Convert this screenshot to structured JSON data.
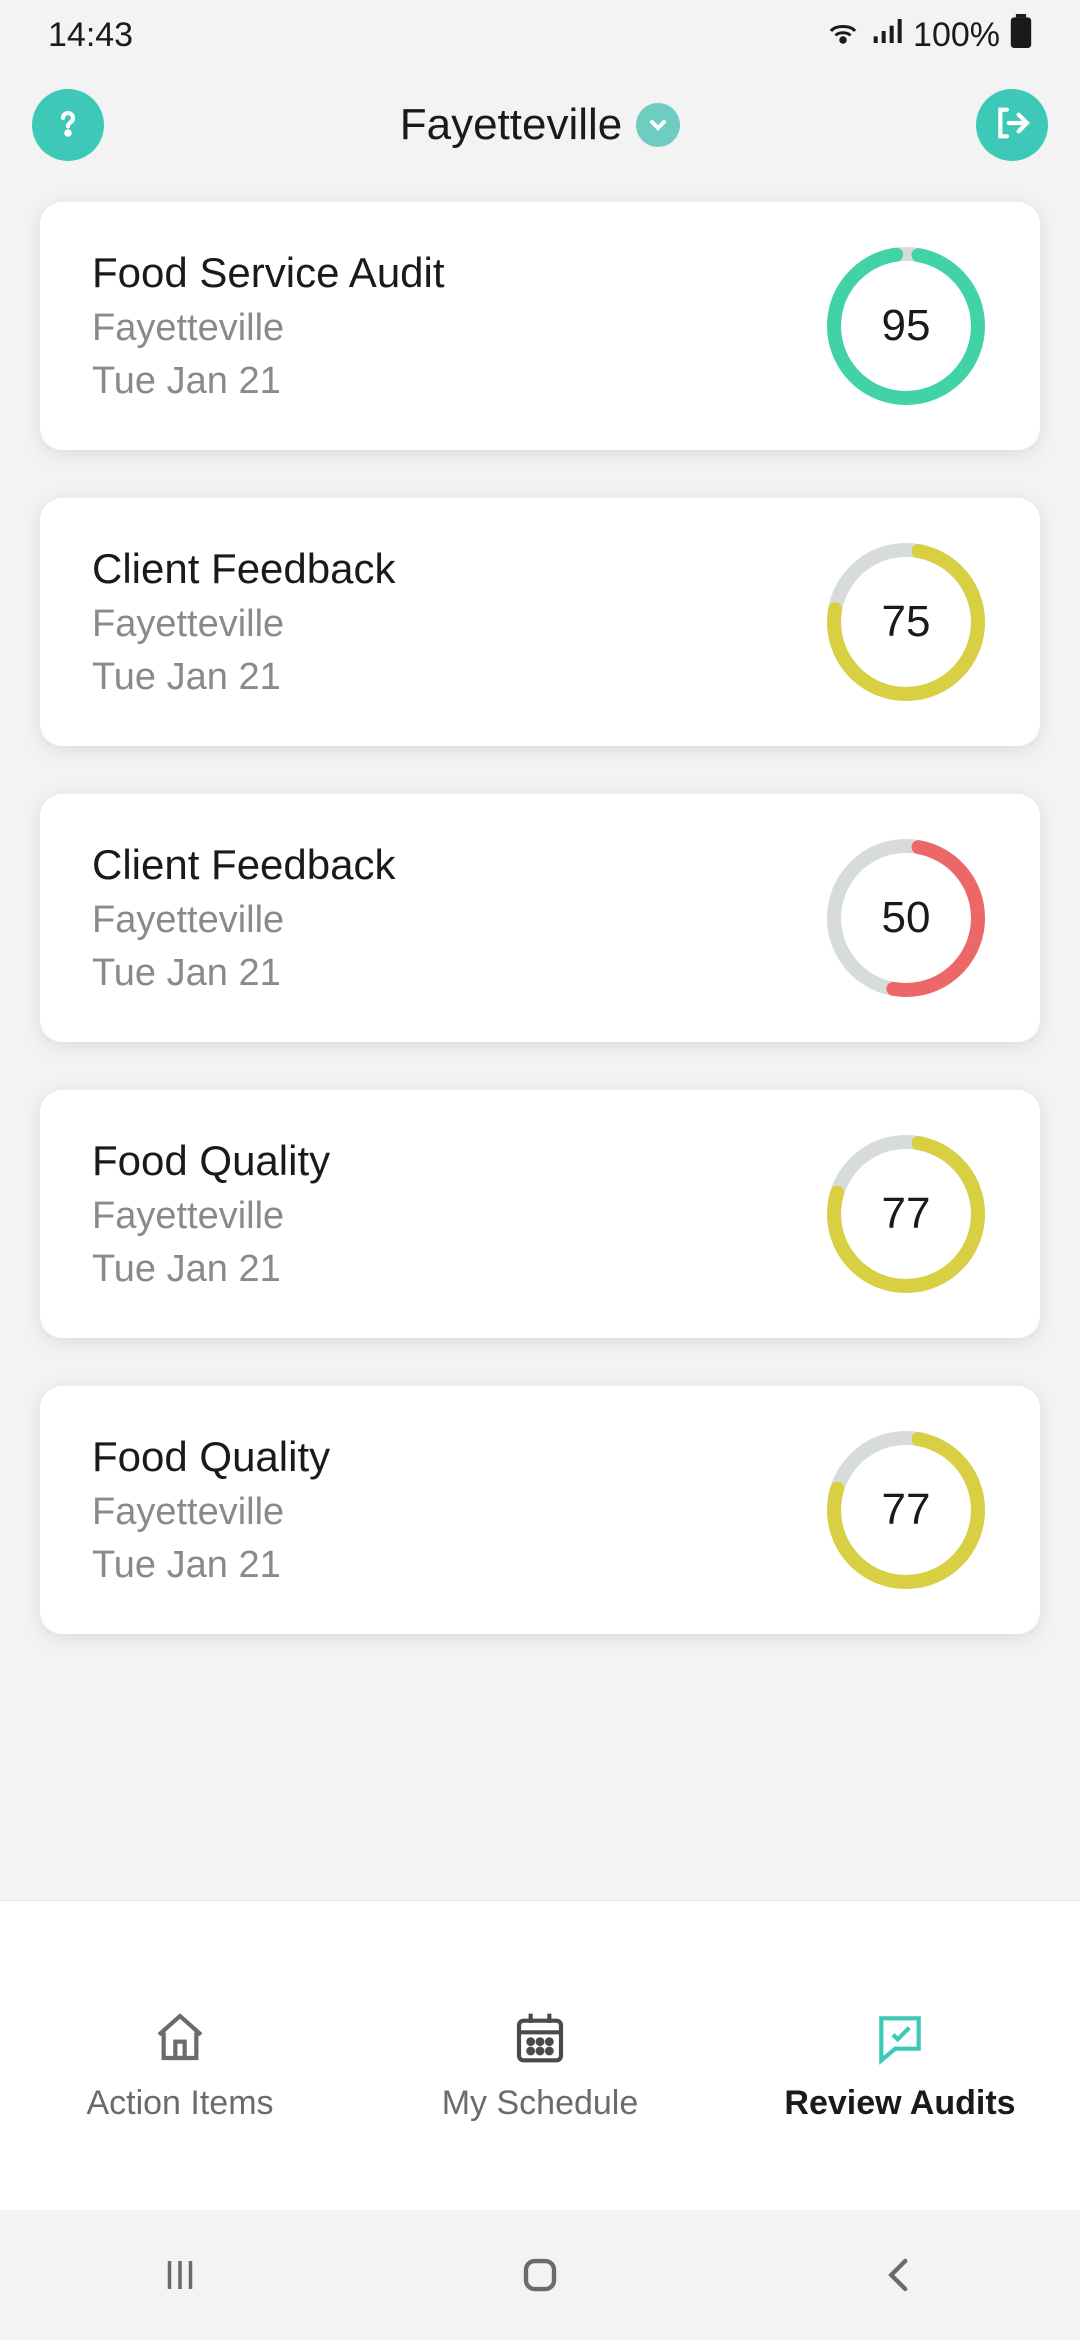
{
  "status": {
    "time": "14:43",
    "battery": "100%"
  },
  "header": {
    "title": "Fayetteville"
  },
  "colors": {
    "primary": "#3ec8b7",
    "ring_green": "#41d3a7",
    "ring_yellow": "#d8cf42",
    "ring_red": "#ec6868",
    "ring_track": "#d7dbdb"
  },
  "audits": [
    {
      "title": "Food Service Audit",
      "location": "Fayetteville",
      "date": "Tue Jan 21",
      "score": 95,
      "color": "ring_green"
    },
    {
      "title": "Client Feedback",
      "location": "Fayetteville",
      "date": "Tue Jan 21",
      "score": 75,
      "color": "ring_yellow"
    },
    {
      "title": "Client Feedback",
      "location": "Fayetteville",
      "date": "Tue Jan 21",
      "score": 50,
      "color": "ring_red"
    },
    {
      "title": "Food Quality",
      "location": "Fayetteville",
      "date": "Tue Jan 21",
      "score": 77,
      "color": "ring_yellow"
    },
    {
      "title": "Food Quality",
      "location": "Fayetteville",
      "date": "Tue Jan 21",
      "score": 77,
      "color": "ring_yellow"
    }
  ],
  "nav": {
    "items": [
      {
        "label": "Action Items",
        "icon": "home",
        "active": false
      },
      {
        "label": "My Schedule",
        "icon": "calendar",
        "active": false
      },
      {
        "label": "Review Audits",
        "icon": "review",
        "active": true
      }
    ]
  }
}
